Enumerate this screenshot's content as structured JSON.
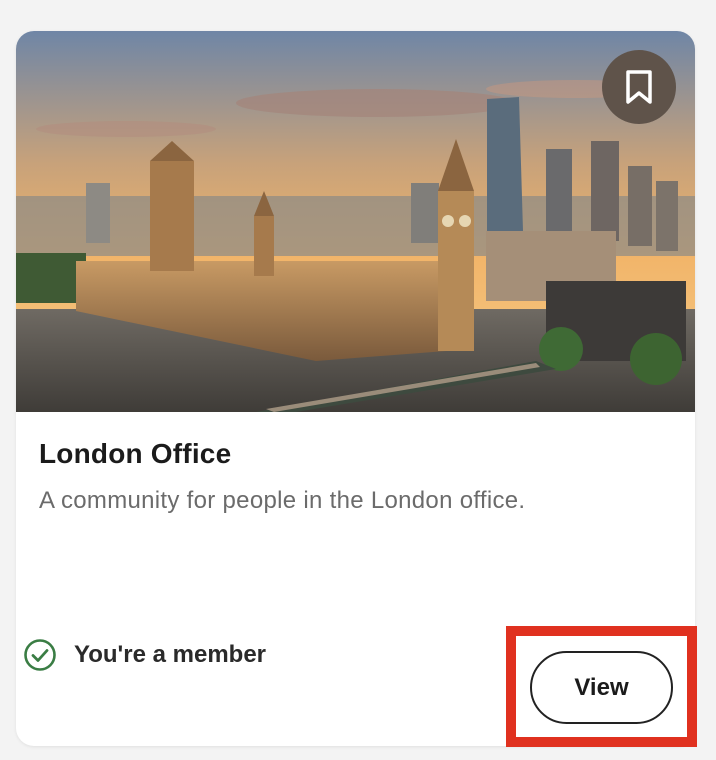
{
  "card": {
    "title": "London Office",
    "description": "A community for people in the London office.",
    "image_subject": "Houses of Parliament and Big Ben at sunset, London"
  },
  "membership": {
    "status_label": "You're a member",
    "status_icon": "check-circle-icon",
    "status_color": "#3a7d44"
  },
  "actions": {
    "view_label": "View",
    "bookmark_icon": "bookmark-icon"
  },
  "colors": {
    "highlight_border": "#e0311f",
    "bookmark_background": "#5f534a"
  }
}
